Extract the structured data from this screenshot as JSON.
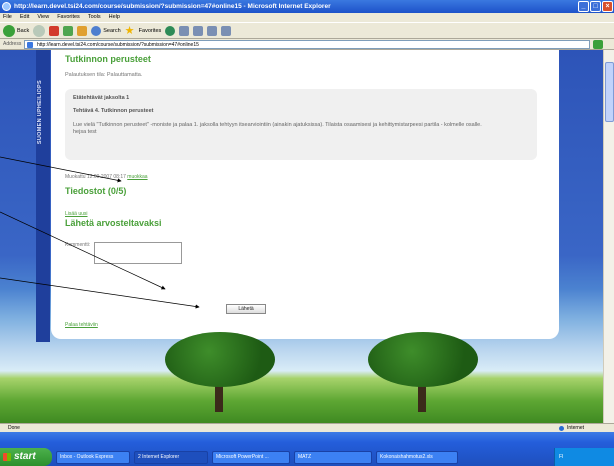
{
  "window": {
    "title": "http://learn.devel.tsi24.com/course/submission/?submission=47#online15 - Microsoft Internet Explorer"
  },
  "menu": [
    "File",
    "Edit",
    "View",
    "Favorites",
    "Tools",
    "Help"
  ],
  "toolbar": {
    "back": "Back",
    "search": "Search",
    "favorites": "Favorites"
  },
  "address": {
    "label": "Address",
    "url": "http://learn.devel.tsi24.com/course/submission/?submission=47#online15"
  },
  "sidebar": {
    "brand": "SUOMEN UPHEILIOPS"
  },
  "page": {
    "heading": "Tutkinnon perusteet",
    "status": "Palautuksen tila: Palauttamatta.",
    "task": {
      "from": "Etätehtävät jaksolta 1",
      "title": "Tehtävä 4. Tutkinnon perusteet",
      "description": "Lue vielä \"Tutkinnon perusteet\" -moniste ja palaa 1. jaksolla tehtyyn itsearviointiin (ainakin ajatuksissa). Tilaista osaamisesi ja kehittymistarpeesi partila - kolmelle osalle.",
      "answer": "hejsa test"
    },
    "modified": {
      "text": "Muokattu 12.09.2007 08:17",
      "edit_link": "muokkaa"
    },
    "files_heading": "Tiedostot (0/5)",
    "add_file_link": "Lisää uusi",
    "send_heading": "Lähetä arvosteltavaksi",
    "comment_label": "Kommentti:",
    "send_button": "Lähetä",
    "back_link": "Palaa tehtäviin"
  },
  "statusbar": {
    "left": "Done",
    "zone": "Internet"
  },
  "taskbar": {
    "start": "start",
    "tasks": [
      "Inbox - Outlook Express",
      "2 Internet Explorer",
      "Microsoft PowerPoint ...",
      "MATZ",
      "Kokonaishahmotus2.xls"
    ],
    "tray_text": "FI"
  }
}
